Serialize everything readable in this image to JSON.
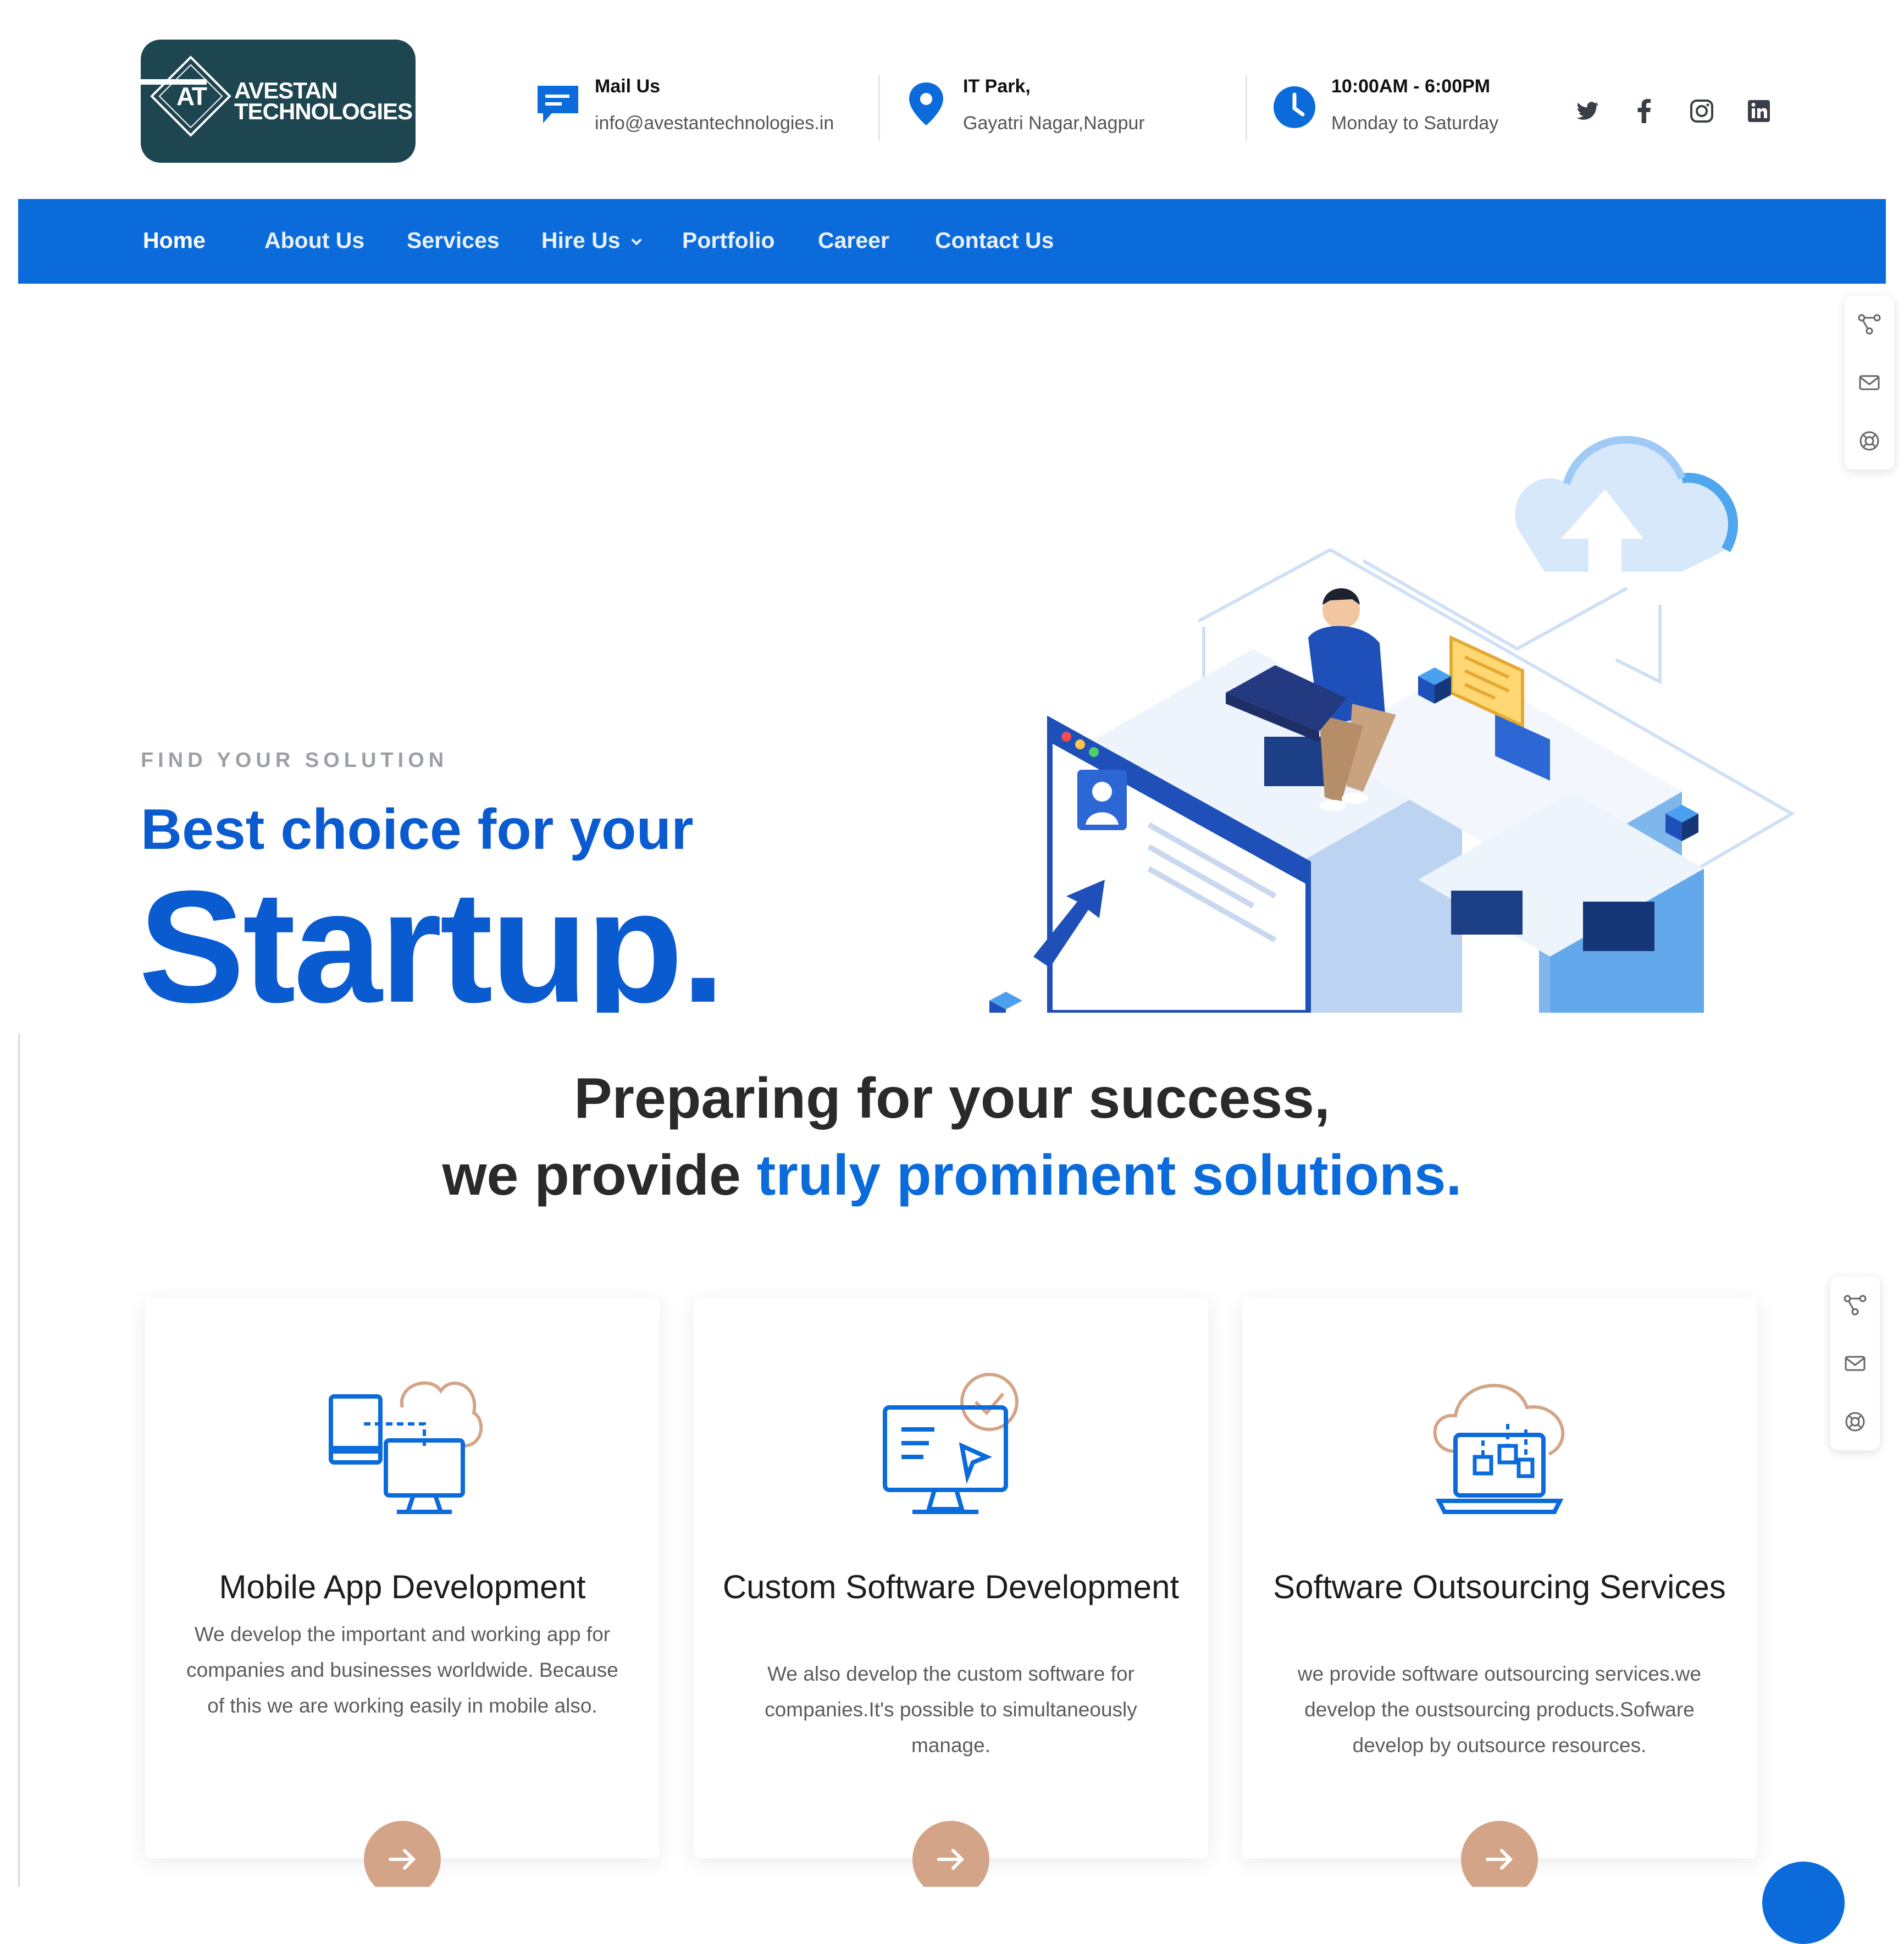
{
  "brand": {
    "logo_monogram": "AT",
    "logo_line1": "AVESTAN",
    "logo_line2": "TECHNOLOGIES"
  },
  "header": {
    "mail": {
      "title": "Mail Us",
      "value": "info@avestantechnologies.in",
      "icon": "chat-icon"
    },
    "location": {
      "title": "IT Park,",
      "value": "Gayatri Nagar,Nagpur",
      "icon": "location-pin-icon"
    },
    "hours": {
      "title": "10:00AM - 6:00PM",
      "value": "Monday to Saturday",
      "icon": "clock-icon"
    },
    "social": [
      "twitter-icon",
      "facebook-icon",
      "instagram-icon",
      "linkedin-icon"
    ]
  },
  "nav": {
    "items": [
      {
        "label": "Home",
        "active": true
      },
      {
        "label": "About Us"
      },
      {
        "label": "Services"
      },
      {
        "label": "Hire Us"
      },
      {
        "label": "Portfolio"
      },
      {
        "label": "Career"
      },
      {
        "label": "Contact Us"
      }
    ]
  },
  "hero": {
    "kicker": "FIND YOUR SOLUTION",
    "title_line1": "Best choice for your",
    "title_line2": "Startup."
  },
  "section": {
    "line1": "Preparing for your success,",
    "line2_prefix": "we provide ",
    "line2_highlight": "truly prominent solutions."
  },
  "services": [
    {
      "title": "Mobile App Development",
      "description": "We develop the important and working app for companies and businesses worldwide. Because of this we are working easily in mobile also.",
      "icon": "devices-cloud-icon"
    },
    {
      "title": "Custom Software Development",
      "description": "We also develop the custom software for companies.It's possible to simultaneously manage.",
      "icon": "monitor-chat-icon"
    },
    {
      "title": "Software Outsourcing Services",
      "description": "we provide software outsourcing services.we develop the oustsourcing products.Sofware develop by outsource resources.",
      "icon": "laptop-cloud-icon"
    }
  ],
  "side_tools": [
    "share-icon",
    "mail-icon",
    "support-icon"
  ],
  "colors": {
    "primary": "#0b6bdb",
    "logo_bg": "#1e4651",
    "accent_button": "#d3a487",
    "heading_dark": "#2a2a2a"
  }
}
